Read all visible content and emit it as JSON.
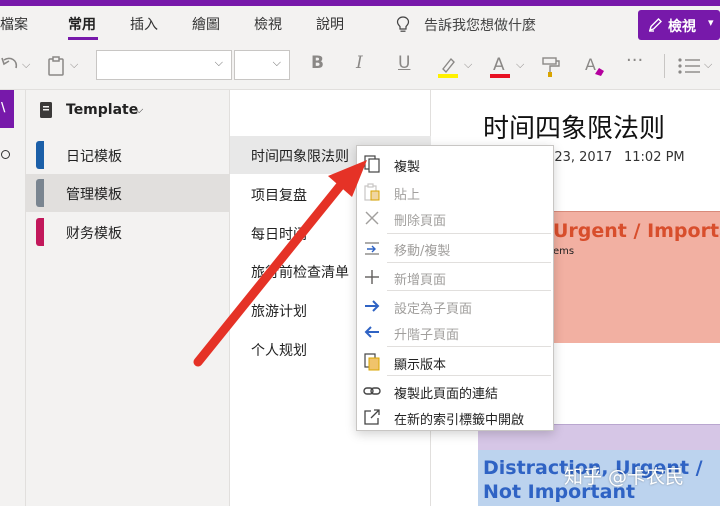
{
  "menu": {
    "items": [
      {
        "label": "檔案",
        "active": false
      },
      {
        "label": "常用",
        "active": true
      },
      {
        "label": "插入",
        "active": false
      },
      {
        "label": "繪圖",
        "active": false
      },
      {
        "label": "檢視",
        "active": false
      },
      {
        "label": "說明",
        "active": false
      }
    ],
    "tell_me": "告訴我您想做什麼",
    "view_button": "檢視"
  },
  "colors": {
    "accent": "#7719aa",
    "highlight_yellow": "#fff100",
    "font_red": "#e81123",
    "section_blue": "#1b5fa8",
    "section_gray": "#7a8590",
    "section_pink": "#c2185b",
    "arrow_red": "#e53226"
  },
  "notebook": {
    "title": "Template",
    "sections": [
      {
        "label": "日记模板",
        "color": "#1b5fa8",
        "selected": false
      },
      {
        "label": "管理模板",
        "color": "#7a8590",
        "selected": true
      },
      {
        "label": "财务模板",
        "color": "#c2185b",
        "selected": false
      }
    ]
  },
  "pages": [
    {
      "label": "时间四象限法则",
      "selected": true
    },
    {
      "label": "项目复盘",
      "selected": false
    },
    {
      "label": "每日时间",
      "selected": false
    },
    {
      "label": "旅行前检查清单",
      "selected": false
    },
    {
      "label": "旅游计划",
      "selected": false
    },
    {
      "label": "个人规划",
      "selected": false
    }
  ],
  "canvas": {
    "title": "时间四象限法则",
    "date": "il 23, 2017",
    "time": "11:02 PM",
    "urgent_heading": "Urgent / Importan",
    "urgent_sub": "ems",
    "distraction_heading": "Distraction, Urgent / Not Important"
  },
  "context_menu": [
    {
      "label": "複製",
      "icon": "copy-icon",
      "disabled": false
    },
    {
      "label": "貼上",
      "icon": "paste-icon",
      "disabled": true
    },
    {
      "label": "刪除頁面",
      "icon": "delete-icon",
      "disabled": true
    },
    {
      "label": "移動/複製",
      "icon": "move-copy-icon",
      "disabled": true
    },
    {
      "label": "新增頁面",
      "icon": "plus-icon",
      "disabled": true
    },
    {
      "label": "設定為子頁面",
      "icon": "arrow-right-icon",
      "disabled": true
    },
    {
      "label": "升階子頁面",
      "icon": "arrow-left-icon",
      "disabled": true
    },
    {
      "label": "顯示版本",
      "icon": "versions-icon",
      "disabled": false
    },
    {
      "label": "複製此頁面的連結",
      "icon": "link-icon",
      "disabled": false
    },
    {
      "label": "在新的索引標籤中開啟",
      "icon": "open-new-tab-icon",
      "disabled": false
    }
  ],
  "watermark": "知乎 @卡农民"
}
